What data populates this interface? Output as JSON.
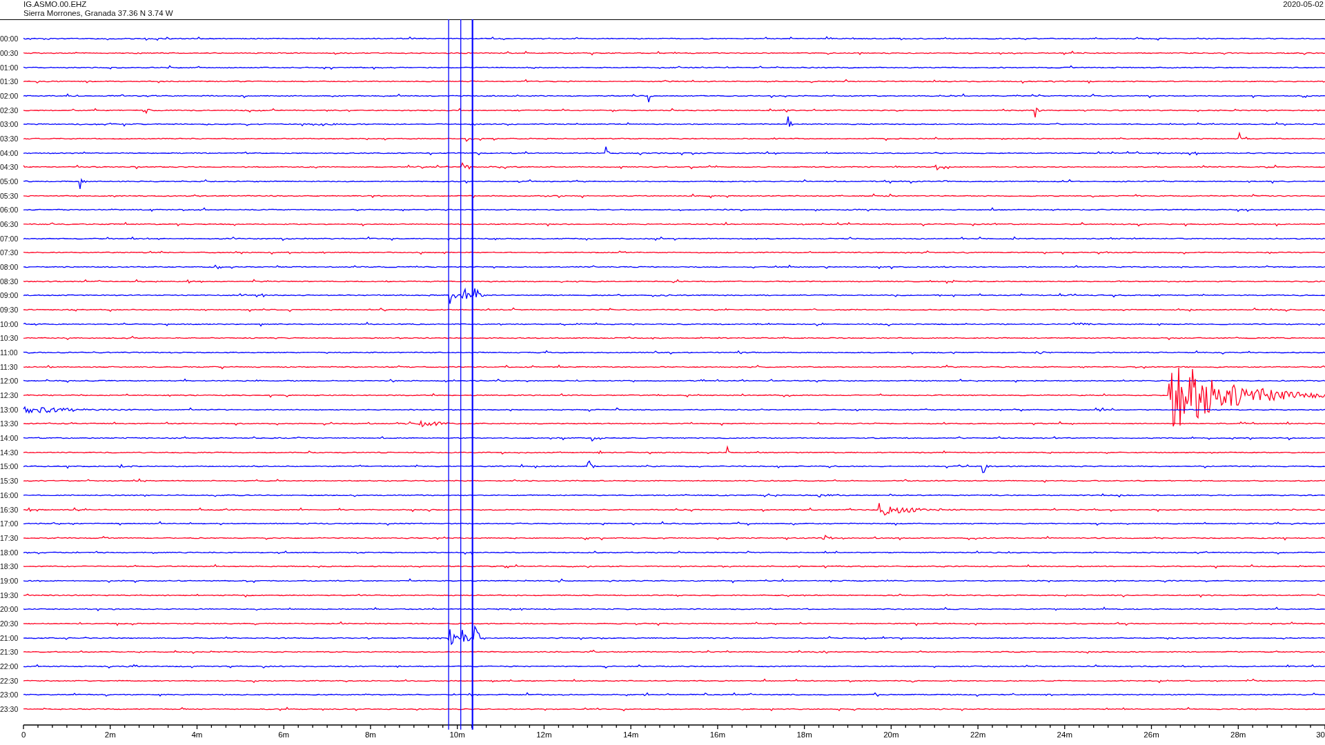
{
  "header": {
    "station": "IG.ASMO.00.EHZ",
    "location": "Sierra Morrones, Granada  37.36 N 3.74 W",
    "date": "2020-05-02"
  },
  "rows": [
    {
      "time": "00:00",
      "color": "#0000ff"
    },
    {
      "time": "00:30",
      "color": "#ff0022"
    },
    {
      "time": "01:00",
      "color": "#0000ff"
    },
    {
      "time": "01:30",
      "color": "#ff0022"
    },
    {
      "time": "02:00",
      "color": "#0000ff"
    },
    {
      "time": "02:30",
      "color": "#ff0022"
    },
    {
      "time": "03:00",
      "color": "#0000ff"
    },
    {
      "time": "03:30",
      "color": "#ff0022"
    },
    {
      "time": "04:00",
      "color": "#0000ff"
    },
    {
      "time": "04:30",
      "color": "#ff0022"
    },
    {
      "time": "05:00",
      "color": "#0000ff"
    },
    {
      "time": "05:30",
      "color": "#ff0022"
    },
    {
      "time": "06:00",
      "color": "#0000ff"
    },
    {
      "time": "06:30",
      "color": "#ff0022"
    },
    {
      "time": "07:00",
      "color": "#0000ff"
    },
    {
      "time": "07:30",
      "color": "#ff0022"
    },
    {
      "time": "08:00",
      "color": "#0000ff"
    },
    {
      "time": "08:30",
      "color": "#ff0022"
    },
    {
      "time": "09:00",
      "color": "#0000ff"
    },
    {
      "time": "09:30",
      "color": "#ff0022"
    },
    {
      "time": "10:00",
      "color": "#0000ff"
    },
    {
      "time": "10:30",
      "color": "#ff0022"
    },
    {
      "time": "11:00",
      "color": "#0000ff"
    },
    {
      "time": "11:30",
      "color": "#ff0022"
    },
    {
      "time": "12:00",
      "color": "#0000ff"
    },
    {
      "time": "12:30",
      "color": "#ff0022"
    },
    {
      "time": "13:00",
      "color": "#0000ff"
    },
    {
      "time": "13:30",
      "color": "#ff0022"
    },
    {
      "time": "14:00",
      "color": "#0000ff"
    },
    {
      "time": "14:30",
      "color": "#ff0022"
    },
    {
      "time": "15:00",
      "color": "#0000ff"
    },
    {
      "time": "15:30",
      "color": "#ff0022"
    },
    {
      "time": "16:00",
      "color": "#0000ff"
    },
    {
      "time": "16:30",
      "color": "#ff0022"
    },
    {
      "time": "17:00",
      "color": "#0000ff"
    },
    {
      "time": "17:30",
      "color": "#ff0022"
    },
    {
      "time": "18:00",
      "color": "#0000ff"
    },
    {
      "time": "18:30",
      "color": "#ff0022"
    },
    {
      "time": "19:00",
      "color": "#0000ff"
    },
    {
      "time": "19:30",
      "color": "#ff0022"
    },
    {
      "time": "20:00",
      "color": "#0000ff"
    },
    {
      "time": "20:30",
      "color": "#ff0022"
    },
    {
      "time": "21:00",
      "color": "#0000ff"
    },
    {
      "time": "21:30",
      "color": "#ff0022"
    },
    {
      "time": "22:00",
      "color": "#0000ff"
    },
    {
      "time": "22:30",
      "color": "#ff0022"
    },
    {
      "time": "23:00",
      "color": "#0000ff"
    },
    {
      "time": "23:30",
      "color": "#ff0022"
    }
  ],
  "x_axis": {
    "labels": [
      "0",
      "2m",
      "4m",
      "6m",
      "8m",
      "10m",
      "12m",
      "14m",
      "16m",
      "18m",
      "20m",
      "22m",
      "24m",
      "26m",
      "28m",
      "30"
    ]
  }
}
